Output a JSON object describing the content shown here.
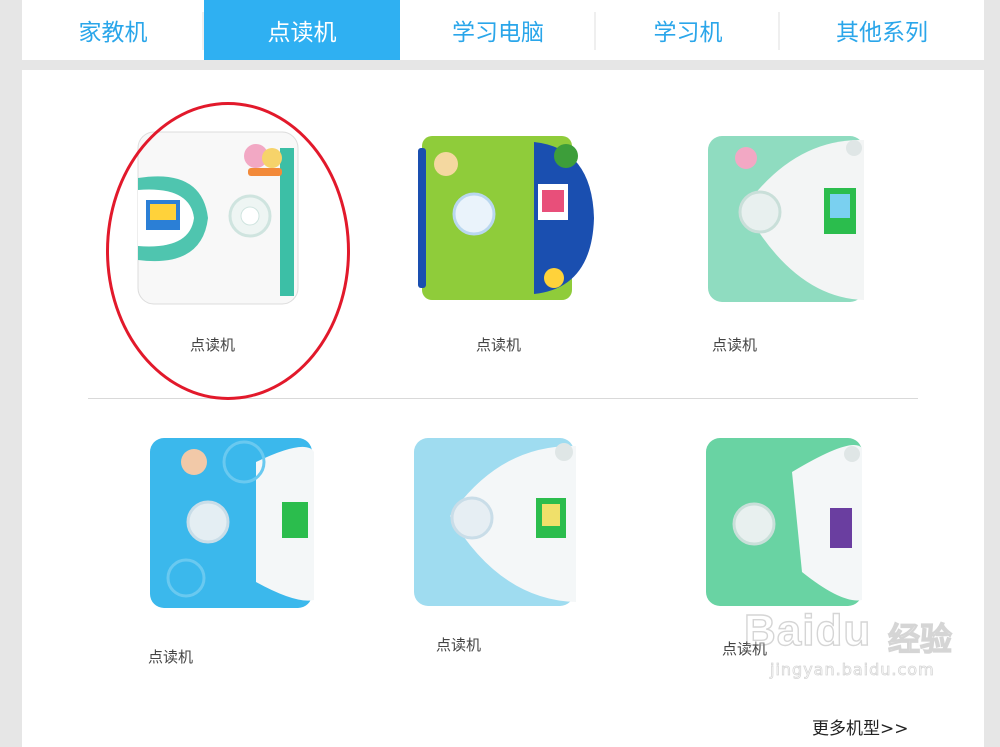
{
  "tabs": [
    {
      "label": "家教机"
    },
    {
      "label": "点读机"
    },
    {
      "label": "学习电脑"
    },
    {
      "label": "学习机"
    },
    {
      "label": "其他系列"
    }
  ],
  "products": [
    {
      "label": "点读机",
      "color": "#ffffff",
      "accent": "#3cbfa6"
    },
    {
      "label": "点读机",
      "color": "#8fcc3a",
      "accent": "#1a4fb0"
    },
    {
      "label": "点读机",
      "color": "#8fdcc0",
      "accent": "#ffffff"
    },
    {
      "label": "点读机",
      "color": "#3bb8ec",
      "accent": "#ffffff"
    },
    {
      "label": "点读机",
      "color": "#9fdcf0",
      "accent": "#ffffff"
    },
    {
      "label": "点读机",
      "color": "#69d3a3",
      "accent": "#ffffff"
    }
  ],
  "more_link": "更多机型>>",
  "watermark": {
    "brand": "Baidu",
    "cn": "经验",
    "url": "jingyan.baidu.com"
  },
  "colors": {
    "tab_active_bg": "#2fb0f2",
    "tab_text": "#2aa6ea",
    "highlight": "#e2192b"
  }
}
